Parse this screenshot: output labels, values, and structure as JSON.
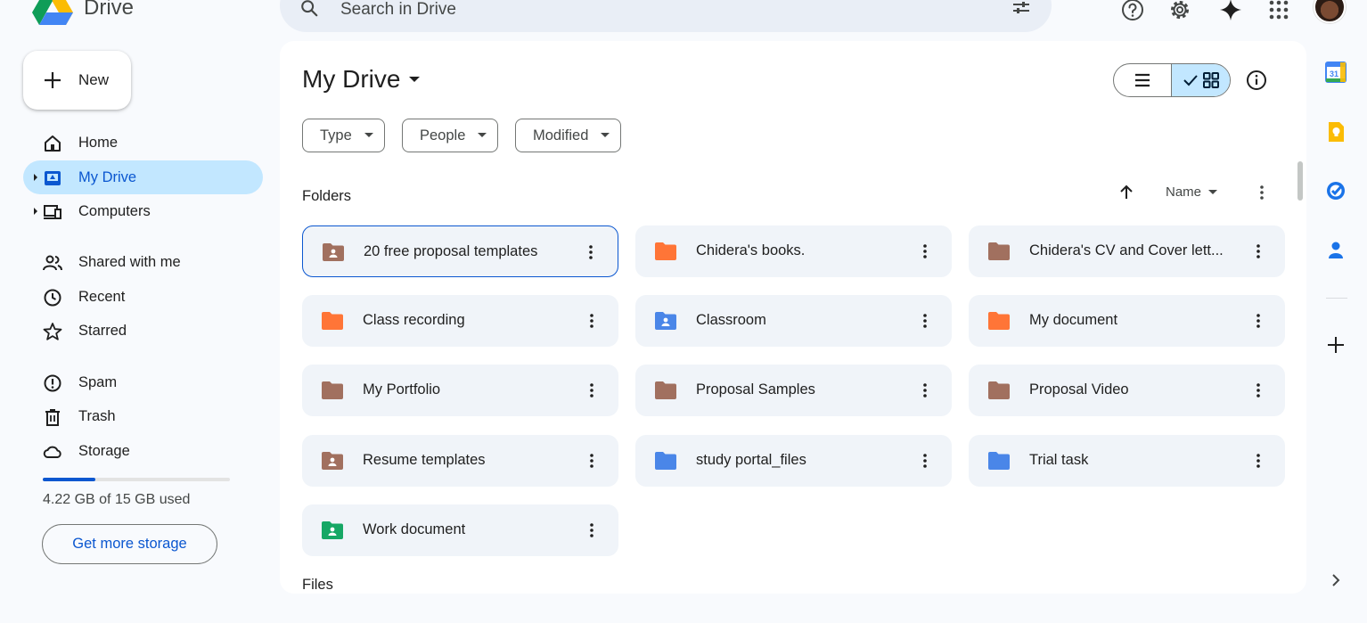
{
  "app": {
    "name": "Drive"
  },
  "search": {
    "placeholder": "Search in Drive"
  },
  "sidebar": {
    "new_label": "New",
    "items": [
      {
        "label": "Home"
      },
      {
        "label": "My Drive"
      },
      {
        "label": "Computers"
      },
      {
        "label": "Shared with me"
      },
      {
        "label": "Recent"
      },
      {
        "label": "Starred"
      },
      {
        "label": "Spam"
      },
      {
        "label": "Trash"
      },
      {
        "label": "Storage"
      }
    ],
    "storage_used_fraction": 0.281,
    "storage_text": "4.22 GB of 15 GB used",
    "get_more_storage": "Get more storage"
  },
  "main": {
    "title": "My Drive",
    "filters": [
      "Type",
      "People",
      "Modified"
    ],
    "folders_label": "Folders",
    "files_label": "Files",
    "sort_label": "Name",
    "folders": [
      {
        "name": "20 free proposal templates",
        "type": "shared",
        "color": "#a1705f"
      },
      {
        "name": "Chidera's books.",
        "type": "plain",
        "color": "#ff7537"
      },
      {
        "name": "Chidera's CV and Cover lett...",
        "type": "plain",
        "color": "#a1705f"
      },
      {
        "name": "Class recording",
        "type": "plain",
        "color": "#ff7537"
      },
      {
        "name": "Classroom",
        "type": "shared",
        "color": "#4a86e8"
      },
      {
        "name": "My document",
        "type": "plain",
        "color": "#ff7537"
      },
      {
        "name": "My Portfolio",
        "type": "plain",
        "color": "#a1705f"
      },
      {
        "name": "Proposal Samples",
        "type": "plain",
        "color": "#a1705f"
      },
      {
        "name": "Proposal Video",
        "type": "plain",
        "color": "#a1705f"
      },
      {
        "name": "Resume templates",
        "type": "shared",
        "color": "#a1705f"
      },
      {
        "name": "study portal_files",
        "type": "plain",
        "color": "#4a86e8"
      },
      {
        "name": "Trial task",
        "type": "plain",
        "color": "#4a86e8"
      },
      {
        "name": "Work document",
        "type": "shared",
        "color": "#16a765"
      }
    ]
  },
  "side_panel": {
    "calendar_day": "31"
  },
  "colors": {
    "accent": "#0b57d0",
    "active_nav": "#c2e7ff"
  }
}
